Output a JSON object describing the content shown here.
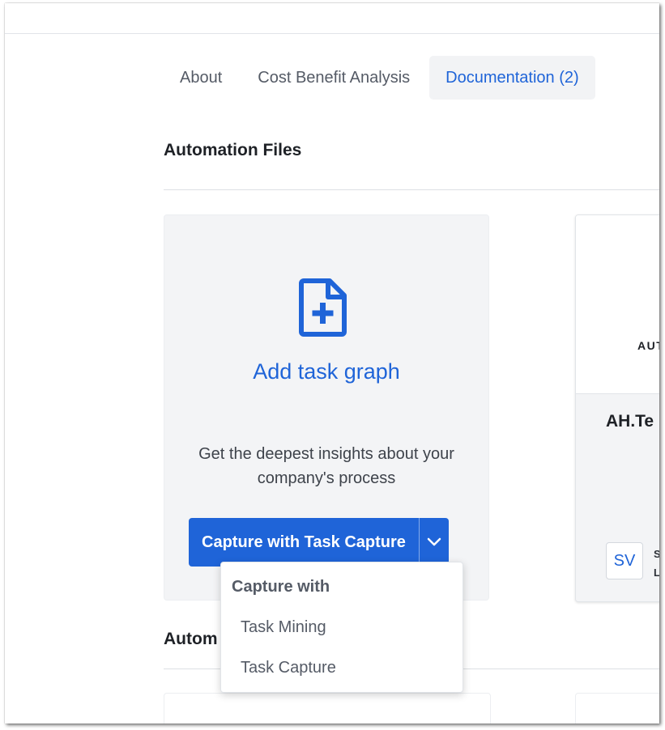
{
  "tabs": [
    {
      "label": "About",
      "active": false
    },
    {
      "label": "Cost Benefit Analysis",
      "active": false
    },
    {
      "label": "Documentation (2)",
      "active": true
    }
  ],
  "sections": {
    "automation_files_title": "Automation Files",
    "second_title_visible": "Autom"
  },
  "add_card": {
    "icon": "file-plus-icon",
    "title": "Add task graph",
    "description": "Get the deepest insights about your company's process",
    "button_label": "Capture with Task Capture",
    "button_arrow_icon": "chevron-down-icon"
  },
  "file_card": {
    "thumb_label": "AUT",
    "name": "AH.Te",
    "avatar_initials": "SV",
    "meta_line_1": "S",
    "meta_line_2": "L"
  },
  "dropdown": {
    "header": "Capture with",
    "items": [
      "Task Mining",
      "Task Capture"
    ]
  },
  "colors": {
    "accent": "#1f64d8",
    "card_bg": "#f3f4f6",
    "text_muted": "#555b66"
  }
}
